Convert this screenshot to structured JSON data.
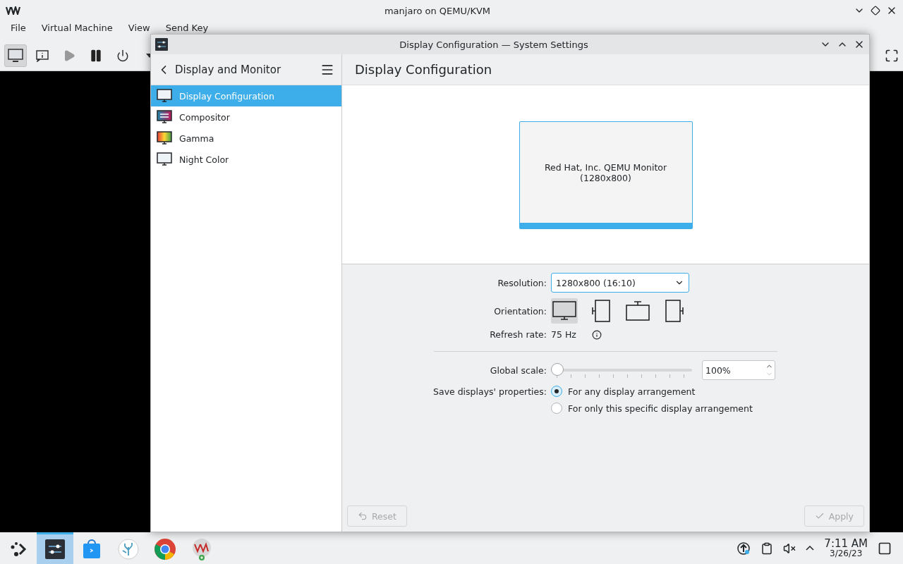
{
  "vm_window": {
    "title": "manjaro on QEMU/KVM",
    "menu": [
      "File",
      "Virtual Machine",
      "View",
      "Send Key"
    ],
    "toolbar": [
      {
        "kind": "console",
        "selected": true
      },
      {
        "kind": "details",
        "selected": false
      },
      {
        "kind": "run",
        "selected": false
      },
      {
        "kind": "pause",
        "selected": false
      },
      {
        "kind": "power",
        "selected": false
      },
      {
        "kind": "dropdown",
        "selected": false
      }
    ]
  },
  "settings_window": {
    "title": "Display Configuration — System Settings",
    "sidebar": {
      "header": "Display and Monitor",
      "items": [
        {
          "label": "Display Configuration",
          "kind": "display",
          "selected": true
        },
        {
          "label": "Compositor",
          "kind": "compositor",
          "selected": false
        },
        {
          "label": "Gamma",
          "kind": "gamma",
          "selected": false
        },
        {
          "label": "Night Color",
          "kind": "display",
          "selected": false
        }
      ]
    },
    "page_title": "Display Configuration",
    "monitor": {
      "name": "Red Hat, Inc. QEMU Monitor",
      "resolution": "(1280x800)",
      "selected": true
    },
    "form": {
      "resolution_label": "Resolution:",
      "resolution_value": "1280x800 (16:10)",
      "orientation_label": "Orientation:",
      "orientations": [
        {
          "kind": "normal",
          "selected": true
        },
        {
          "kind": "left",
          "selected": false
        },
        {
          "kind": "inverted",
          "selected": false
        },
        {
          "kind": "right",
          "selected": false
        }
      ],
      "refresh_label": "Refresh rate:",
      "refresh_value": "75 Hz",
      "scale_label": "Global scale:",
      "scale": {
        "level": 0
      },
      "scale_value": "100%",
      "save_label": "Save displays' properties:",
      "save_options": [
        {
          "label": "For any display arrangement",
          "selected": true
        },
        {
          "label": "For only this specific display arrangement",
          "selected": false
        }
      ]
    },
    "buttons": [
      {
        "label": "Reset",
        "kind": "reset",
        "disabled": true
      },
      {
        "label": "Apply",
        "kind": "apply",
        "disabled": true
      }
    ]
  },
  "taskbar": {
    "apps": [
      {
        "kind": "launcher",
        "selected": false
      },
      {
        "kind": "settings",
        "selected": true
      },
      {
        "kind": "store",
        "selected": false
      },
      {
        "kind": "coral",
        "selected": false
      },
      {
        "kind": "browser",
        "selected": false
      },
      {
        "kind": "vm",
        "selected": false
      }
    ],
    "time": "7:11 AM",
    "date": "3/26/23"
  }
}
